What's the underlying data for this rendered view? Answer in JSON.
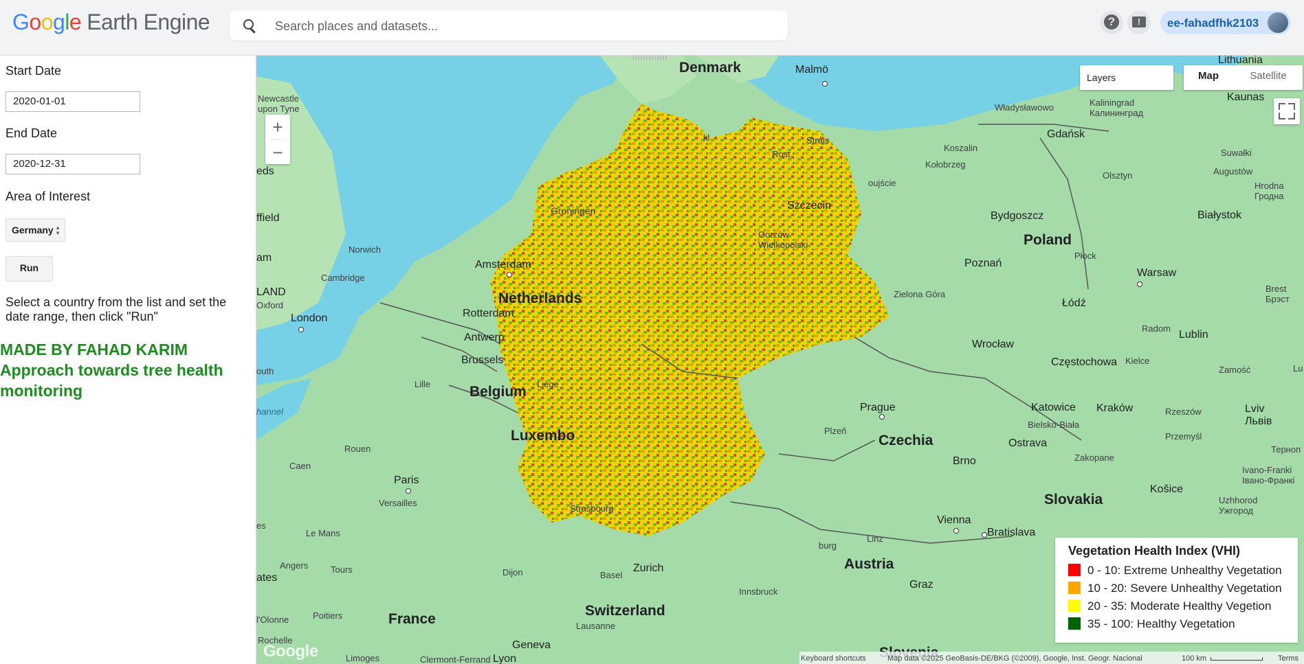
{
  "header": {
    "logo_google": [
      "G",
      "o",
      "o",
      "g",
      "l",
      "e"
    ],
    "logo_product": "Earth Engine",
    "search_placeholder": "Search places and datasets...",
    "help_label": "?",
    "account_name": "ee-fahadfhk2103"
  },
  "panel": {
    "start_label": "Start Date",
    "start_value": "2020-01-01",
    "end_label": "End Date",
    "end_value": "2020-12-31",
    "aoi_label": "Area of Interest",
    "aoi_value": "Germany",
    "run_label": "Run",
    "description": "Select a country from the list and set the date range, then click \"Run\"",
    "credit_line1": "MADE BY FAHAD KARIM",
    "credit_line2": "Approach towards tree health monitoring"
  },
  "map": {
    "layers_label": "Layers",
    "map_type_map": "Map",
    "map_type_satellite": "Satellite",
    "zoom_in": "+",
    "zoom_out": "−",
    "google_logo": "Google",
    "footer": {
      "shortcuts": "Keyboard shortcuts",
      "data": "Map data ©2025 GeoBasis-DE/BKG (©2009), Google, Inst. Geogr. Nacional",
      "scale": "100 km",
      "terms": "Terms"
    },
    "labels": {
      "denmark": "Denmark",
      "malmo": "Malmö",
      "lithuania": "Lithuania",
      "newcastle": "Newcastle upon Tyne",
      "kaliningrad": "Kaliningrad Калининград",
      "wladyslawowo": "Władysławowo",
      "kaunas": "Kaunas",
      "gdansk": "Gdańsk",
      "koszalin": "Koszalin",
      "kolobrzeg": "Kołobrzeg",
      "olsztyn": "Olsztyn",
      "suwalki": "Suwałki",
      "augustow": "Augustów",
      "hrodna": "Hrodna Гродна",
      "eds": "eds",
      "ffield": "ffield",
      "groningen": "Groningen",
      "szczecin": "Szczecin",
      "bydgoszcz": "Bydgoszcz",
      "bialystok": "Białystok",
      "norwich": "Norwich",
      "am": "am",
      "gorzow": "Gorzów Wielkopolski",
      "poland": "Poland",
      "cambridge": "Cambridge",
      "amsterdam": "Amsterdam",
      "poznan": "Poznań",
      "plock": "Płock",
      "warsaw": "Warsaw",
      "brest": "Brest Брэст",
      "land": "LAND",
      "oxford": "Oxford",
      "netherlands": "Netherlands",
      "london": "London",
      "rotterdam": "Rotterdam",
      "zielona": "Zielona Góra",
      "lodz": "Łódź",
      "antwerp": "Antwerp",
      "wroclaw": "Wrocław",
      "radom": "Radom",
      "lublin": "Lublin",
      "brussels": "Brussels",
      "czestochowa": "Częstochowa",
      "kielce": "Kielce",
      "zamosc": "Zamość",
      "outh": "outh",
      "lille": "Lille",
      "belgium": "Belgium",
      "liege": "Liège",
      "prague": "Prague",
      "katowice": "Katowice",
      "krakow": "Kraków",
      "rzeszow": "Rzeszów",
      "lviv": "Lviv Львів",
      "channel": "hannel",
      "luxembourg": "Luxembo",
      "plzen": "Plzeň",
      "czechia": "Czechia",
      "bielsko": "Bielsko-Biała",
      "przemysl": "Przemyśl",
      "ostrava": "Ostrava",
      "ternopil": "Терноп",
      "caen": "Caen",
      "rouen": "Rouen",
      "brno": "Brno",
      "zakopane": "Zakopane",
      "ivano": "Ivano-Franki Івано-Франкі",
      "paris": "Paris",
      "versailles": "Versailles",
      "strasbourg": "Strasbourg",
      "slovakia": "Slovakia",
      "kosice": "Košice",
      "uzhhorod": "Uzhhorod Ужгород",
      "es": "es",
      "lemans": "Le Mans",
      "linz": "Linz",
      "vienna": "Vienna",
      "bratislava": "Bratislava",
      "angers": "Angers",
      "tours": "Tours",
      "basel": "Basel",
      "zurich": "Zurich",
      "burg": "burg",
      "austria": "Austria",
      "ates": "ates",
      "dijon": "Dijon",
      "innsbruck": "Innsbruck",
      "graz": "Graz",
      "switzerland": "Switzerland",
      "olonne": "l'Olonne",
      "poitiers": "Poitiers",
      "france": "France",
      "lausanne": "Lausanne",
      "rochelle": "Rochelle",
      "geneva": "Geneva",
      "limoges": "Limoges",
      "clermont": "Clermont-Ferrand",
      "lyon": "Lyon",
      "slovenia": "Slovenia",
      "lu": "Lu",
      "stralsund": "Strals",
      "rost": "Rost",
      "kl": "kl",
      "swinoujscie": "oujście"
    }
  },
  "legend": {
    "title": "Vegetation Health Index (VHI)",
    "items": [
      {
        "label": "0 - 10: Extreme Unhealthy Vegetation",
        "color": "#ff0000"
      },
      {
        "label": "10 - 20: Severe Unhealthy Vegetation",
        "color": "#ffa500"
      },
      {
        "label": "20 - 35: Moderate Healthy Vegetion",
        "color": "#ffff00"
      },
      {
        "label": "35 - 100: Healthy Vegetation",
        "color": "#006400"
      }
    ]
  },
  "colors": {
    "sea": "#76d1e6",
    "land": "#a5dba8",
    "credit": "#1e8c1e",
    "accent": "#1a73e8"
  }
}
